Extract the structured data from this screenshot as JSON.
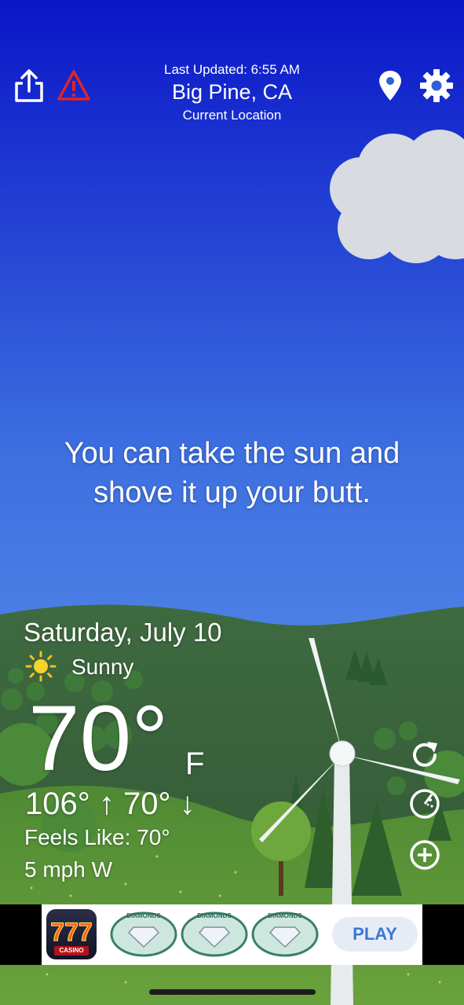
{
  "header": {
    "last_updated": "Last Updated: 6:55 AM",
    "location": "Big Pine, CA",
    "location_sub": "Current Location",
    "icons": [
      "share-icon",
      "alert-icon",
      "location-pin-icon",
      "settings-gear-icon"
    ]
  },
  "quote": "You can take the sun and shove it up your butt.",
  "weather": {
    "date": "Saturday, July 10",
    "condition": "Sunny",
    "temperature": "70°",
    "unit": "F",
    "high_low": "106° ↑ 70° ↓",
    "feels_like": "Feels Like: 70°",
    "wind": "5 mph W"
  },
  "side_buttons": [
    "refresh-icon",
    "radar-icon",
    "add-icon"
  ],
  "ad": {
    "logo_text": "CASINO",
    "badge_text": "DIAMONDS",
    "play_label": "PLAY"
  },
  "colors": {
    "sky_top": "#0a16c8",
    "sky_bottom": "#6aa4ee",
    "hill_dark": "#2f5a35",
    "grass": "#5f9a37",
    "accent_play": "#3a77d6"
  }
}
